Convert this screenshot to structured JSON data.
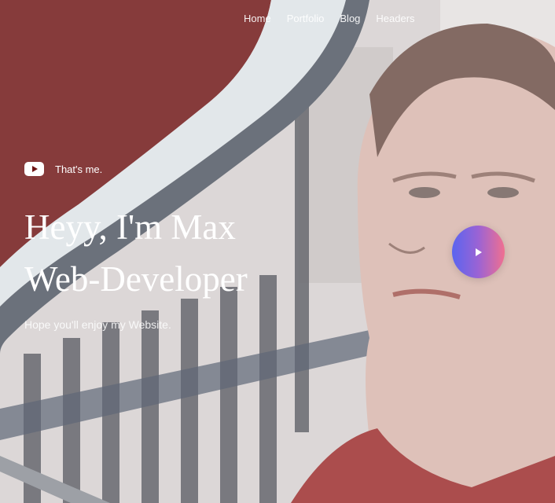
{
  "nav": {
    "items": [
      {
        "label": "Home"
      },
      {
        "label": "Portfolio"
      },
      {
        "label": "Blog"
      },
      {
        "label": "Headers"
      }
    ]
  },
  "hero": {
    "tagline": "That's me.",
    "tagline_icon": "youtube-icon",
    "headline_line1": "Heyy, I'm Max",
    "headline_line2": "Web-Developer",
    "subtitle": "Hope you'll enjoy my Website.",
    "play_icon": "play-icon"
  },
  "colors": {
    "accent_red": "#6e1414",
    "wave_light": "#dfe6ea",
    "wave_dark": "#4d5662",
    "play_gradient_start": "#5965f0",
    "play_gradient_end": "#f07090"
  }
}
